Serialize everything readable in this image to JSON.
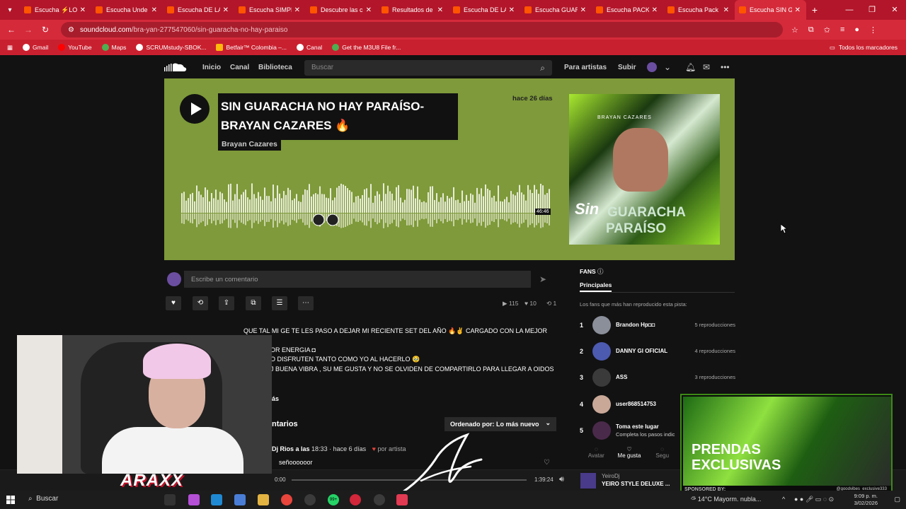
{
  "browser": {
    "tabs": [
      {
        "label": "Escucha ⚡LO"
      },
      {
        "label": "Escucha Unde"
      },
      {
        "label": "Escucha DE LA"
      },
      {
        "label": "Escucha SIMPL"
      },
      {
        "label": "Descubre las c"
      },
      {
        "label": "Resultados de"
      },
      {
        "label": "Escucha DE LA"
      },
      {
        "label": "Escucha GUAR"
      },
      {
        "label": "Escucha PACK"
      },
      {
        "label": "Escucha Pack P"
      },
      {
        "label": "Escucha SIN G"
      }
    ],
    "url_host": "soundcloud.com",
    "url_path": "/bra-yan-277547060/sin-guaracha-no-hay-paraiso",
    "bookmarks": [
      "Gmail",
      "YouTube",
      "Maps",
      "SCRUMstudy-SBOK...",
      "Betfair™ Colombia –...",
      "Canal",
      "Get the M3U8 File fr..."
    ],
    "all_bookmarks": "Todos los marcadores"
  },
  "header": {
    "nav": [
      "Inicio",
      "Canal",
      "Biblioteca"
    ],
    "search_placeholder": "Buscar",
    "for_artists": "Para artistas",
    "upload": "Subir"
  },
  "track": {
    "title_line1": "SIN GUARACHA NO HAY PARAÍSO-",
    "title_line2": "BRAYAN CAZARES 🔥",
    "artist": "Brayan Cazares",
    "posted": "hace 26 días",
    "duration": "46:46",
    "artwork_text": {
      "top": "BRAYAN CAZARES",
      "sin": "Sin",
      "guaracha": "GUARACHA",
      "paraiso": "PARAÍSO"
    }
  },
  "comment_box": {
    "placeholder": "Escribe un comentario"
  },
  "stats": {
    "plays": "115",
    "likes": "10",
    "reposts": "1"
  },
  "description": {
    "line1": "QUE TAL MI GE TE LES PASO A DEJAR MI RECIENTE SET DEL AÑO 🔥✌ CARGADO CON LA MEJOR",
    "line2": "OR ENERGIA ◘",
    "line3": "O DISFRUTEN TANTO COMO YO AL HACERLO 🥹",
    "line4": "J BUENA VIBRA , SU ME GUSTA Y NO SE OLVIDEN DE COMPARTIRLO PARA LLEGAR A OIDOS",
    "more": "ás"
  },
  "comments": {
    "heading": "ntarios",
    "sort": "Ordenado por: Lo más nuevo",
    "first_user": "Dj Rios a las",
    "first_time": "18:33",
    "first_ago": "· hace 6 días",
    "first_by": "por artista",
    "first_text": "señoooooor"
  },
  "fans": {
    "heading": "FANS",
    "tab": "Principales",
    "subtitle": "Los fans que más han reproducido esta pista:",
    "list": [
      {
        "rank": "1",
        "name": "Brandon Hp◘◘",
        "plays": "5 reproducciones"
      },
      {
        "rank": "2",
        "name": "DANNY GI OFICIAL",
        "plays": "4 reproducciones"
      },
      {
        "rank": "3",
        "name": "ASS",
        "plays": "3 reproducciones"
      },
      {
        "rank": "4",
        "name": "user868514753",
        "plays": ""
      },
      {
        "rank": "5",
        "name": "Toma este lugar",
        "plays": "",
        "sub": "Completa los pasos indic"
      }
    ],
    "bottom_tabs": [
      "Avatar",
      "Me gusta",
      "Segu"
    ]
  },
  "player": {
    "elapsed": "0:00",
    "total": "1:39:24",
    "user": "YeiroDj",
    "track": "YEIRO STYLE DELUXE ..."
  },
  "overlay": {
    "brand": "ARAXX",
    "ad_line1": "PRENDAS",
    "ad_line2": "EXCLUSIVAS",
    "sponsored": "SPONSORED BY:",
    "handle": "@goodvibes_exclusive333"
  },
  "taskbar": {
    "search": "Buscar",
    "weather": "14°C  Mayorm. nubla...",
    "time": "9:09 p. m.",
    "date": "3/02/2026",
    "badge": "99+"
  }
}
